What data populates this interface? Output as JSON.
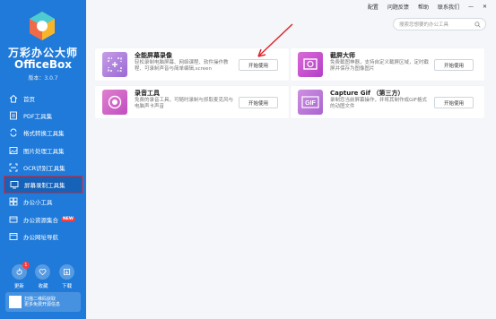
{
  "app": {
    "name": "万彩办公大师",
    "subtitle": "OfficeBox",
    "version": "版本：3.0.7"
  },
  "topbar": {
    "links": [
      "配置",
      "问题反馈",
      "帮助",
      "联系我们"
    ],
    "minimize": "—",
    "close": "✕"
  },
  "search": {
    "placeholder": "搜索您想要的办公工具"
  },
  "sidebar": {
    "items": [
      {
        "label": "首页",
        "icon": "home-icon"
      },
      {
        "label": "PDF工具集",
        "icon": "pdf-icon"
      },
      {
        "label": "格式转换工具集",
        "icon": "convert-icon"
      },
      {
        "label": "图片处理工具集",
        "icon": "image-icon"
      },
      {
        "label": "OCR识别工具集",
        "icon": "scan-icon"
      },
      {
        "label": "屏幕录制工具集",
        "icon": "screen-icon",
        "active": true
      },
      {
        "label": "办公小工具",
        "icon": "tools-icon"
      },
      {
        "label": "办公资源集合",
        "icon": "resource-icon",
        "badge": "NEW"
      },
      {
        "label": "办公网址导航",
        "icon": "nav-icon"
      }
    ],
    "bottom": [
      {
        "label": "更新",
        "icon": "update-icon",
        "badge": "1"
      },
      {
        "label": "收藏",
        "icon": "heart-icon"
      },
      {
        "label": "下载",
        "icon": "download-icon"
      }
    ],
    "qr": {
      "line1": "扫描二维码获取",
      "line2": "更多免费开源信息"
    }
  },
  "cards": [
    {
      "title": "全能屏幕录像",
      "desc": "轻松录制电脑屏幕、网络课程、软件操作教程、可录制声音与简单编辑,screen",
      "button": "开始使用",
      "icon": "screen-record-icon",
      "color": "#ab7bd6"
    },
    {
      "title": "截屏大师",
      "desc": "免费截图神器，支持自定义截屏区域，定时截屏并保存为图像图片",
      "button": "开始使用",
      "icon": "screenshot-icon",
      "color": "#c94fd1"
    },
    {
      "title": "录音工具",
      "desc": "免费的录音工具，可随时录制与抓取麦克风与电脑声卡声音",
      "button": "开始使用",
      "icon": "audio-record-icon",
      "color": "#d05fc8"
    },
    {
      "title": "Capture Gif （第三方）",
      "desc": "录制您当前屏幕操作，并将其制作成GIF格式的动图文件",
      "button": "开始使用",
      "icon": "gif-icon",
      "color": "#b96fd6"
    }
  ]
}
